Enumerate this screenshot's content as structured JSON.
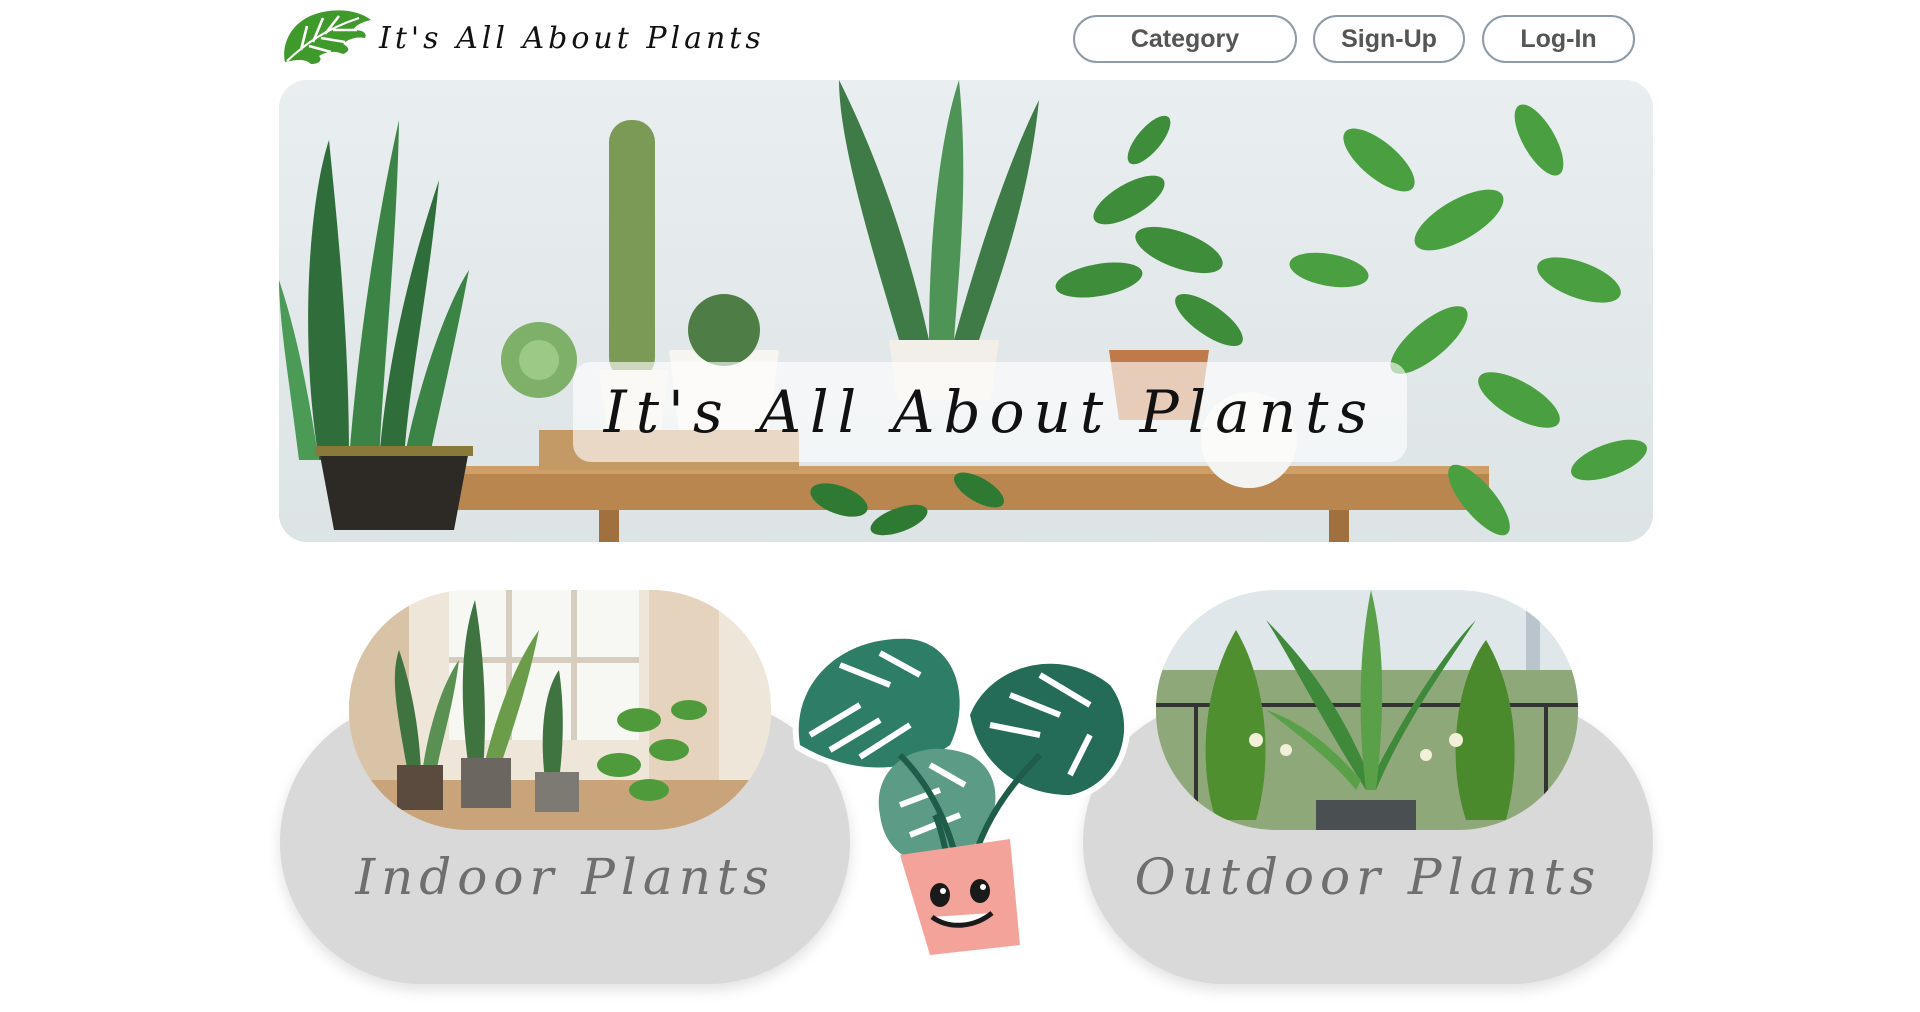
{
  "header": {
    "logo_text": "It's All About Plants",
    "logo_icon": "monstera-leaf-icon"
  },
  "nav": {
    "category_label": "Category",
    "signup_label": "Sign-Up",
    "login_label": "Log-In"
  },
  "hero": {
    "title": "It's All About Plants",
    "image": "houseplants-on-wooden-bench"
  },
  "categories": [
    {
      "label": "Indoor Plants",
      "image": "indoor-potted-plants-by-window"
    },
    {
      "label": "Outdoor Plants",
      "image": "outdoor-plants-on-balcony"
    }
  ],
  "mascot": {
    "image": "smiling-potted-monstera-sticker"
  },
  "colors": {
    "card_background": "#d9d9d9",
    "button_border": "#8d9aa8",
    "button_text": "#555555",
    "plant_green": "#3a8a2e",
    "monstera_green": "#2e7d66",
    "pot_pink": "#f4a39a"
  }
}
